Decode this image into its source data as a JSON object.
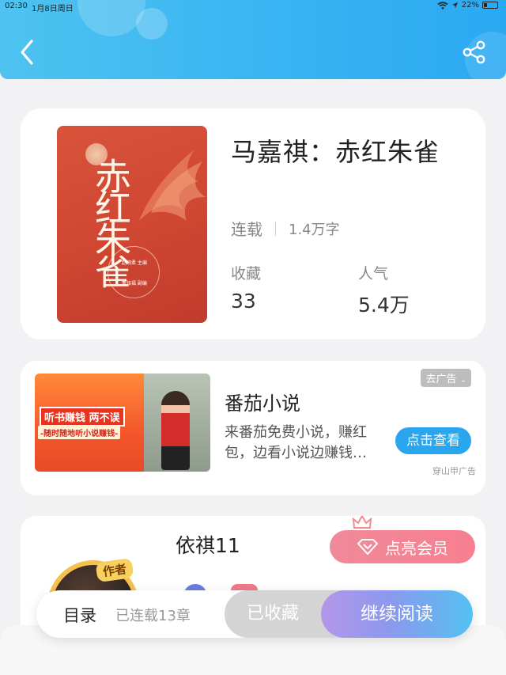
{
  "status_bar": {
    "time": "02:30",
    "date": "1月8日周日",
    "battery": "22%",
    "battery_level": 0.22
  },
  "book": {
    "title": "马嘉祺：赤红朱雀",
    "status": "连载",
    "word_count": "1.4万字",
    "stats": [
      {
        "label": "收藏",
        "value": "33"
      },
      {
        "label": "人气",
        "value": "5.4万"
      }
    ],
    "cover_text": {
      "main": "赤红朱雀",
      "author": "赵婉柔 主编",
      "editor": "董铭福 副编"
    }
  },
  "ad": {
    "badge": "去广告",
    "app_name": "番茄小说",
    "description": "来番茄免费小说，赚红包，边看小说边赚钱…",
    "cta": "点击查看",
    "source": "穿山甲广告",
    "banner_line1": "听书赚钱",
    "banner_line1b": "两不误",
    "banner_line2": "-随时随地听小说赚钱-"
  },
  "author": {
    "name": "依祺11",
    "vip_button": "点亮会员",
    "tag": "作者"
  },
  "bottom_bar": {
    "toc_label": "目录",
    "chapter_count": "已连载13章",
    "collected_label": "已收藏",
    "read_label": "继续阅读"
  },
  "colors": {
    "header": "#39b4f2",
    "cta_blue": "#29a6ee",
    "vip_pink": "#f77f8f",
    "cover_red": "#cf4632"
  }
}
